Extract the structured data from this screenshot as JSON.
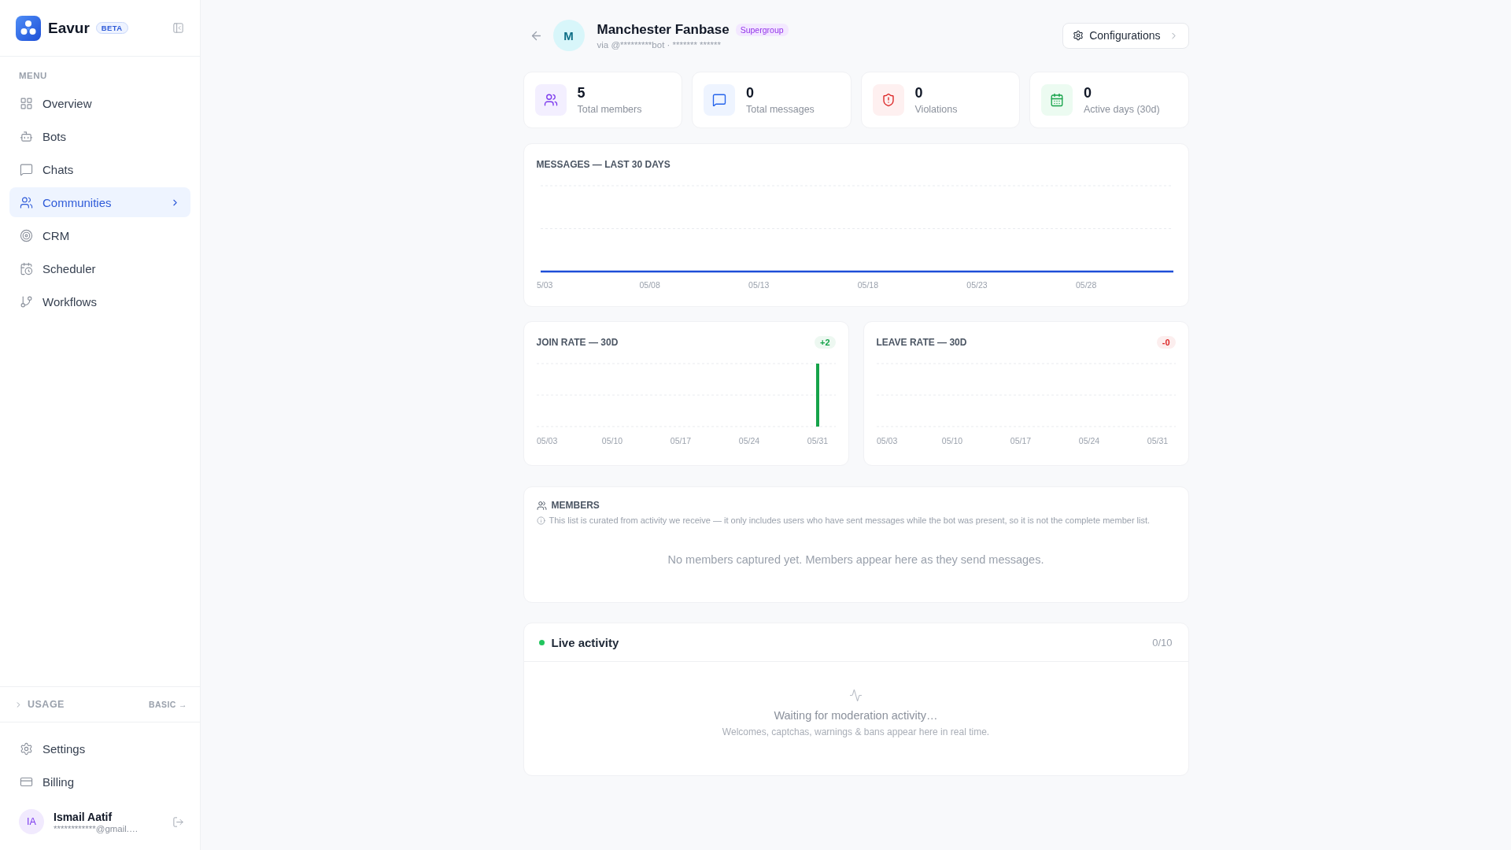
{
  "sidebar": {
    "brand": {
      "name": "Eavur",
      "badge": "BETA"
    },
    "menu_label": "MENU",
    "items": [
      {
        "label": "Overview",
        "selected": false
      },
      {
        "label": "Bots",
        "selected": false
      },
      {
        "label": "Chats",
        "selected": false
      },
      {
        "label": "Communities",
        "selected": true
      },
      {
        "label": "CRM",
        "selected": false
      },
      {
        "label": "Scheduler",
        "selected": false
      },
      {
        "label": "Workflows",
        "selected": false
      }
    ],
    "usage": {
      "label": "USAGE",
      "plan": "BASIC →",
      "expanded": false
    },
    "footer_items": [
      {
        "label": "Settings",
        "selected": false
      },
      {
        "label": "Billing",
        "selected": false
      }
    ],
    "user": {
      "initials": "IA",
      "name": "Ismail Aatif",
      "email": "************@gmail.…"
    }
  },
  "header": {
    "avatar": "M",
    "title": "Manchester Fanbase",
    "badge": "Supergroup",
    "subtitle": "via @*********bot · ******* ******",
    "button": "Configurations"
  },
  "stats": [
    {
      "value": "5",
      "label": "Total members"
    },
    {
      "value": "0",
      "label": "Total messages"
    },
    {
      "value": "0",
      "label": "Violations"
    },
    {
      "value": "0",
      "label": "Active days (30d)"
    }
  ],
  "messages_chart": {
    "title": "MESSAGES — LAST 30 DAYS",
    "x_labels": [
      "5/03",
      "05/08",
      "05/13",
      "05/18",
      "05/23",
      "05/28"
    ]
  },
  "rate_charts": [
    {
      "title": "JOIN RATE — 30D",
      "badge": {
        "text": "+2",
        "color": "#16a34a"
      },
      "x_labels": [
        "05/03",
        "05/10",
        "05/17",
        "05/24",
        "05/31"
      ]
    },
    {
      "title": "LEAVE RATE — 30D",
      "badge": {
        "text": "-0",
        "color": "#dc2626"
      },
      "x_labels": [
        "05/03",
        "05/10",
        "05/17",
        "05/24",
        "05/31"
      ]
    }
  ],
  "members": {
    "title": "MEMBERS",
    "note": "This list is curated from activity we receive — it only includes users who have sent messages while the bot was present, so it is not the complete member list.",
    "empty": "No members captured yet. Members appear here as they send messages."
  },
  "live_activity": {
    "title": "Live activity",
    "live": true,
    "count": "0/10",
    "empty_title": "Waiting for moderation activity…",
    "empty_subtitle": "Welcomes, captchas, warnings & bans appear here in real time."
  }
}
